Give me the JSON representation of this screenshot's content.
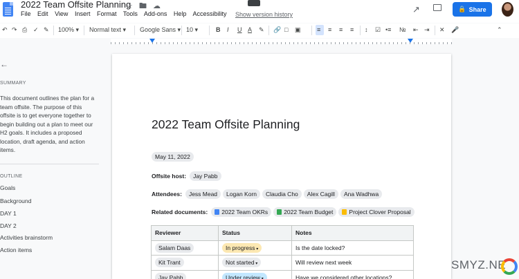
{
  "app": {
    "doc_title": "2022 Team Offsite Planning",
    "menu": [
      "File",
      "Edit",
      "View",
      "Insert",
      "Format",
      "Tools",
      "Add-ons",
      "Help",
      "Accessibility"
    ],
    "version_link": "Show version history",
    "share_label": "Share",
    "icons": {
      "star": "star-icon",
      "folder": "folder-icon",
      "cloud": "cloud-icon"
    }
  },
  "toolbar": {
    "zoom": "100%",
    "style": "Normal text",
    "font": "Google Sans",
    "size": "10",
    "bold": "B",
    "italic": "I",
    "underline": "U",
    "text_color": "A"
  },
  "sidebar": {
    "summary_heading": "SUMMARY",
    "summary_text": "This document outlines the plan for a team offsite. The purpose of this offsite is to get everyone together to begin building out a plan to meet our H2 goals. It includes a proposed location, draft agenda, and action items.",
    "outline_heading": "OUTLINE",
    "outline": [
      "Goals",
      "Background",
      "DAY 1",
      "DAY 2",
      "Activities brainstorm",
      "Action items"
    ]
  },
  "document": {
    "heading": "2022 Team Offsite Planning",
    "date": "May 11, 2022",
    "host_label": "Offsite host:",
    "host": "Jay Pabb",
    "attendees_label": "Attendees:",
    "attendees": [
      "Jess Mead",
      "Logan Korn",
      "Claudia Cho",
      "Alex Cagill",
      "Ana Wadhwa"
    ],
    "related_label": "Related documents:",
    "related": [
      {
        "name": "2022 Team OKRs",
        "kind": "doc"
      },
      {
        "name": "2022 Team Budget",
        "kind": "sheet"
      },
      {
        "name": "Project Clover Proposal",
        "kind": "slide"
      }
    ],
    "table": {
      "headers": [
        "Reviewer",
        "Status",
        "Notes"
      ],
      "rows": [
        {
          "reviewer": "Salam Daas",
          "status": "In progress",
          "status_color": "#fce8b2",
          "notes": "Is the date locked?"
        },
        {
          "reviewer": "Kit Trant",
          "status": "Not started",
          "status_color": "#e8eaed",
          "notes": "Will review next week"
        },
        {
          "reviewer": "Jay Pabb",
          "status": "Under review",
          "status_color": "#c2e7ff",
          "notes": "Have we considered other locations?"
        }
      ]
    }
  },
  "watermark": "SMYZ.NE",
  "colors": {
    "accent": "#1a73e8",
    "page": "#ffffff",
    "background": "#f8f9fa"
  }
}
